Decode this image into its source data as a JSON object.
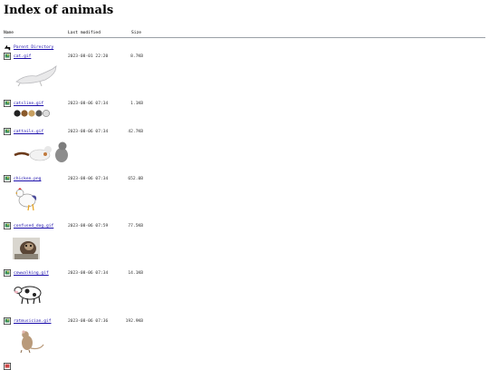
{
  "page": {
    "title": "Index of animals"
  },
  "columns": {
    "name": "Name",
    "modified": "Last modified",
    "size": "Size"
  },
  "parent": {
    "label": "Parent Directory"
  },
  "files": [
    {
      "name": "cat.gif",
      "modified": "2023-08-01 22:20",
      "size": "8.7KB",
      "icon": "image-file-icon",
      "thumb": "cat-thumbnail"
    },
    {
      "name": "catsline.gif",
      "modified": "2023-08-06 07:34",
      "size": "1.1KB",
      "icon": "image-file-icon",
      "thumb": "cats-line-thumbnail"
    },
    {
      "name": "cattails.gif",
      "modified": "2023-08-06 07:34",
      "size": "42.7KB",
      "icon": "image-file-icon",
      "thumb": "cat-tails-thumbnail"
    },
    {
      "name": "chicken.png",
      "modified": "2023-08-06 07:34",
      "size": "652.0B",
      "icon": "image-file-icon",
      "thumb": "chicken-thumbnail"
    },
    {
      "name": "confused_dog.gif",
      "modified": "2023-08-06 07:59",
      "size": "77.5KB",
      "icon": "image-file-icon",
      "thumb": "confused-dog-thumbnail"
    },
    {
      "name": "cowwalking.gif",
      "modified": "2023-08-06 07:34",
      "size": "14.1KB",
      "icon": "image-file-icon",
      "thumb": "cow-walking-thumbnail"
    },
    {
      "name": "ratmusician.gif",
      "modified": "2023-08-06 07:36",
      "size": "192.9KB",
      "icon": "image-file-icon",
      "thumb": "rat-musician-thumbnail"
    }
  ]
}
